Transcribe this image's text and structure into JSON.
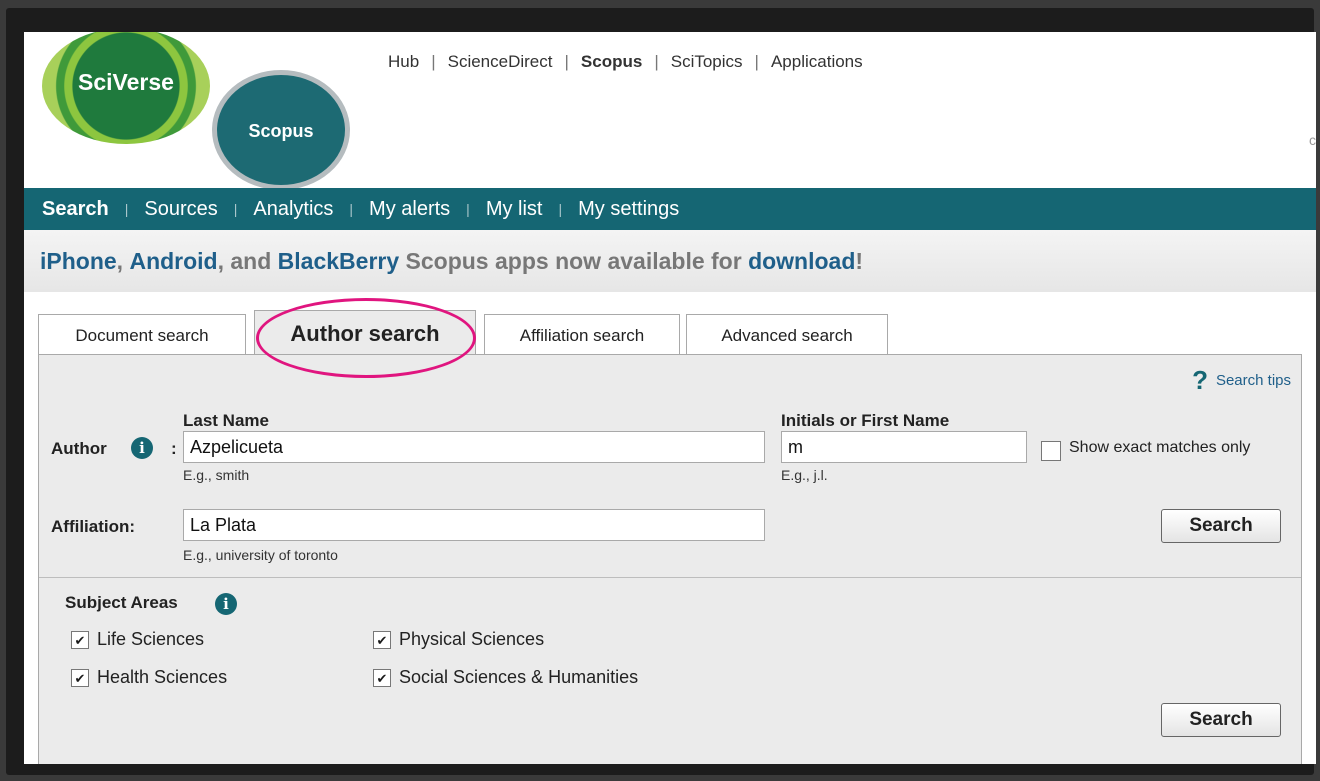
{
  "logos": {
    "sciverse": "SciVerse",
    "scopus": "Scopus"
  },
  "top_links": [
    "Hub",
    "ScienceDirect",
    "Scopus",
    "SciTopics",
    "Applications"
  ],
  "top_links_bold_index": 2,
  "edge_char": "c",
  "nav": {
    "items": [
      "Search",
      "Sources",
      "Analytics",
      "My alerts",
      "My list",
      "My settings"
    ],
    "separator": "|"
  },
  "banner": {
    "part1": "iPhone",
    "part2": ", ",
    "part3": "Android",
    "part4": ", and ",
    "part5": "BlackBerry",
    "part6": " Scopus apps now available for ",
    "part7": "download",
    "part8": "!"
  },
  "tabs": [
    "Document search",
    "Author search",
    "Affiliation search",
    "Advanced search"
  ],
  "search_tips": "Search tips",
  "author": {
    "label": "Author",
    "colon": ":",
    "last_name_label": "Last Name",
    "last_name_value": "Azpelicueta",
    "last_name_hint": "E.g., smith",
    "first_name_label": "Initials or First Name",
    "first_name_value": "m",
    "first_name_hint": "E.g., j.l.",
    "exact_label": "Show exact matches only",
    "exact_checked": false
  },
  "affiliation": {
    "label": "Affiliation:",
    "value": "La Plata",
    "hint": "E.g., university of toronto"
  },
  "search_button": "Search",
  "subject_areas": {
    "title": "Subject Areas",
    "items": [
      {
        "label": "Life Sciences",
        "checked": true
      },
      {
        "label": "Physical Sciences",
        "checked": true
      },
      {
        "label": "Health Sciences",
        "checked": true
      },
      {
        "label": "Social Sciences & Humanities",
        "checked": true
      }
    ]
  },
  "colors": {
    "teal": "#156673",
    "link_blue": "#1f5f8a",
    "highlight": "#e0157f"
  },
  "icons": {
    "info": "info-icon",
    "help": "question-icon",
    "check": "checkmark-icon"
  }
}
